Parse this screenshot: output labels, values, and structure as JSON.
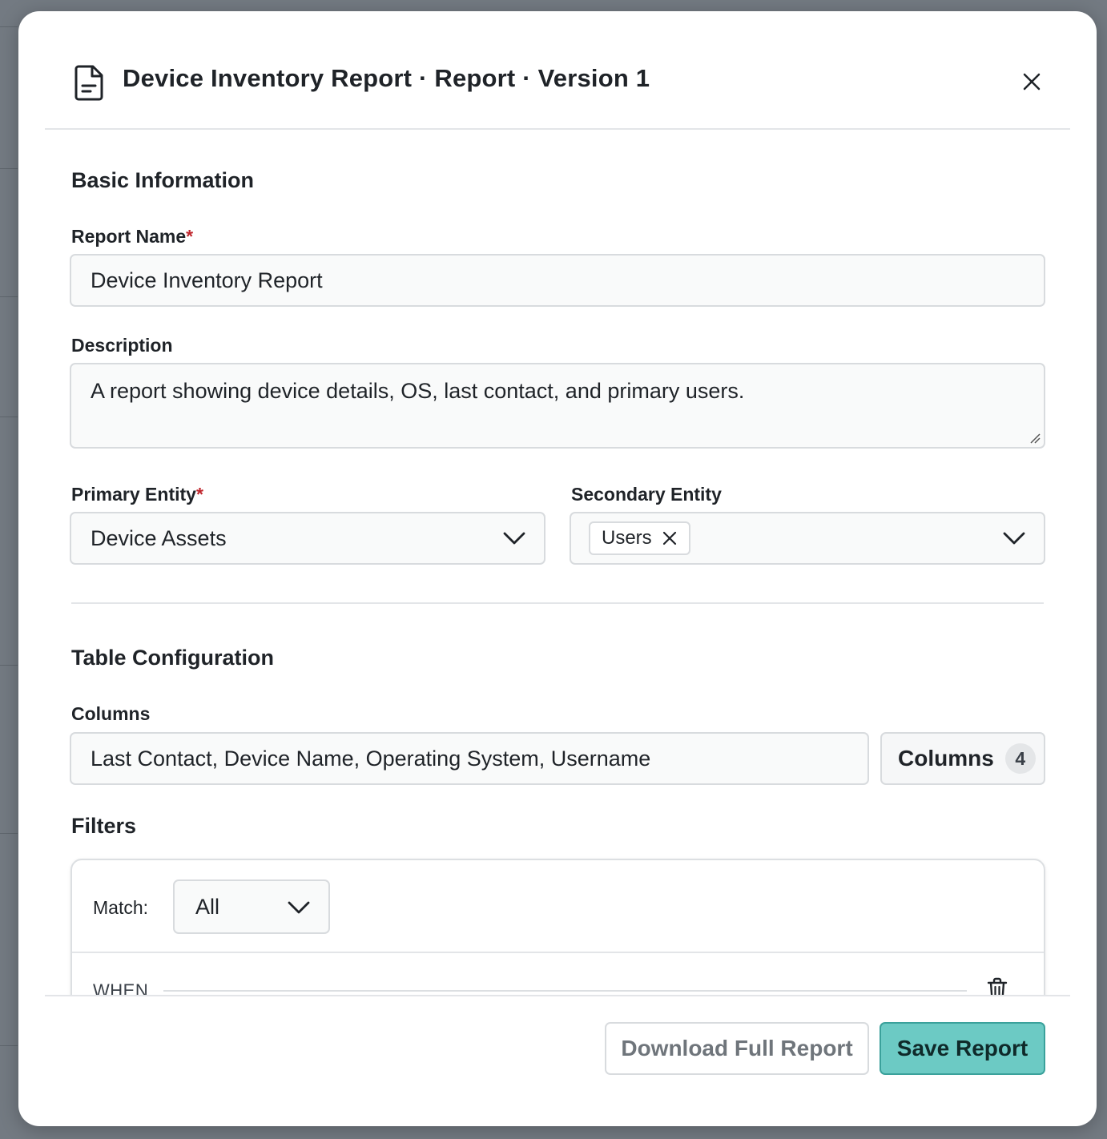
{
  "modal": {
    "title": "Device Inventory Report · Report · Version 1"
  },
  "basic_info": {
    "section_title": "Basic Information",
    "report_name_label": "Report Name",
    "required_mark": "*",
    "report_name_value": "Device Inventory Report",
    "description_label": "Description",
    "description_value": "A report showing device details, OS, last contact, and primary users.",
    "primary_entity_label": "Primary Entity",
    "primary_entity_value": "Device Assets",
    "secondary_entity_label": "Secondary Entity",
    "secondary_entity_tags": [
      "Users"
    ]
  },
  "table_config": {
    "section_title": "Table Configuration",
    "columns_label": "Columns",
    "columns_value": "Last Contact, Device Name, Operating System, Username",
    "columns_button_label": "Columns",
    "columns_count": "4"
  },
  "filters": {
    "section_title": "Filters",
    "match_label": "Match:",
    "match_value": "All",
    "when_label": "WHEN"
  },
  "footer": {
    "download_label": "Download Full Report",
    "save_label": "Save Report"
  },
  "colors": {
    "primary_button": "#6ccac4",
    "required": "#c0262d",
    "overlay": "#6b7178"
  },
  "icons": [
    "document-icon",
    "close-icon",
    "chevron-down-icon",
    "tag-remove-icon",
    "resize-grip-icon",
    "trash-icon"
  ]
}
